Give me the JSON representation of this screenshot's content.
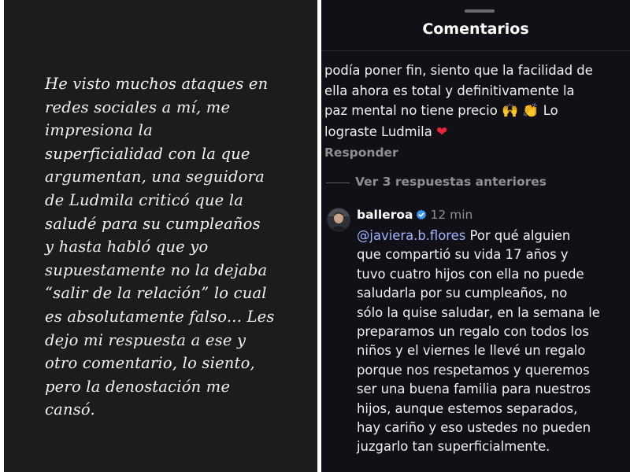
{
  "story": {
    "lines": [
      "He visto muchos ataques en",
      "redes sociales a mí, me",
      "impresiona la",
      "superficialidad con la que",
      "argumentan, una seguidora",
      "de Ludmila criticó que la",
      "saludé para su cumpleaños",
      "y hasta habló que yo",
      "supuestamente no la dejaba",
      "“salir de la relación” lo cual",
      "es absolutamente falso... Les",
      "dejo mi respuesta a ese y",
      "otro comentario, lo siento,",
      "pero la denostación me",
      "cansó."
    ]
  },
  "sheet": {
    "title": "Comentarios"
  },
  "comment1": {
    "lines": [
      "podía poner fin, siento que la facilidad de",
      "ella ahora es total y definitivamente la",
      "paz mental no tiene precio"
    ],
    "emoji_1": "🙌",
    "emoji_2": "👏",
    "after_emoji": "Lo",
    "line4_text": "lograste Ludmila",
    "heart": "❤",
    "reply_label": "Responder"
  },
  "thread": {
    "view_previous_label": "Ver 3 respuestas anteriores"
  },
  "comment2": {
    "username": "balleroa",
    "verified_icon": "verified-badge-icon",
    "time": "12 min",
    "mention": "@javiera.b.flores",
    "first_line_rest": "Por qué alguien",
    "lines": [
      "que compartió su vida 17 años y",
      "tuvo cuatro hijos con ella no puede",
      "saludarla por su cumpleaños, no",
      "sólo la quise saludar, en la semana le",
      "preparamos un regalo con todos los",
      "niños y el viernes le llevé un regalo",
      "porque nos respetamos y queremos",
      "ser una buena familia para nuestros",
      "hijos, aunque estemos separados,",
      "hay cariño y eso ustedes no pueden",
      "juzgarlo tan superficialmente."
    ]
  },
  "colors": {
    "story_bg": "#1c1c1c",
    "comments_bg": "#101016",
    "mention": "#9fb6ff",
    "verified": "#3897f0",
    "secondary_text": "#8e8e93",
    "heart": "#e8233c"
  }
}
